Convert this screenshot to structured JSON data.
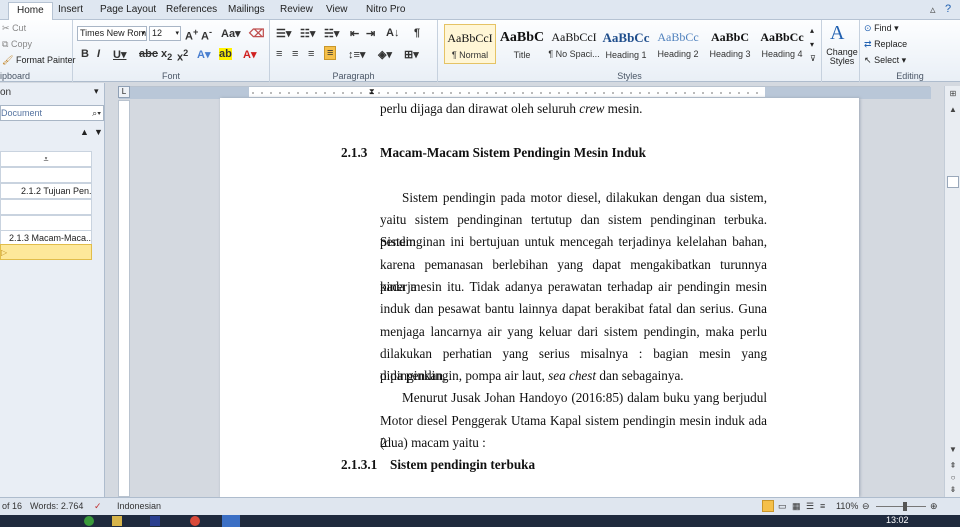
{
  "tabs": [
    "Home",
    "Insert",
    "Page Layout",
    "References",
    "Mailings",
    "Review",
    "View",
    "Nitro Pro"
  ],
  "clipboard": {
    "cut": "Cut",
    "copy": "Copy",
    "format_painter": "Format Painter",
    "label": "ipboard"
  },
  "font": {
    "name": "Times New Rom",
    "size": "12",
    "label": "Font"
  },
  "paragraph": {
    "label": "Paragraph"
  },
  "styles": {
    "label": "Styles",
    "items": [
      {
        "sample": "AaBbCcI",
        "name": "¶ Normal"
      },
      {
        "sample": "AaBbC",
        "name": "Title"
      },
      {
        "sample": "AaBbCcI",
        "name": "¶ No Spaci..."
      },
      {
        "sample": "AaBbCc",
        "name": "Heading 1"
      },
      {
        "sample": "AaBbCc",
        "name": "Heading 2"
      },
      {
        "sample": "AaBbC",
        "name": "Heading 3"
      },
      {
        "sample": "AaBbCc",
        "name": "Heading 4"
      }
    ],
    "change_styles": "Change Styles"
  },
  "editing": {
    "find": "Find",
    "replace": "Replace",
    "select": "Select",
    "label": "Editing"
  },
  "nav": {
    "title": "on",
    "search_text": "Document",
    "items": [
      "2.1.2 Tujuan Pen...",
      "2.1.3  Macam-Maca..."
    ]
  },
  "document": {
    "line_top": "perlu dijaga dan dirawat oleh seluruh",
    "line_top_italic": "crew",
    "line_top_end": "mesin.",
    "heading_num": "2.1.3",
    "heading_text": "Macam-Macam Sistem Pendingin Mesin Induk",
    "p1": [
      "Sistem pendingin pada motor diesel, dilakukan dengan dua sistem,",
      "yaitu sistem pendinginan tertutup dan sistem pendinginan terbuka. Sistem",
      "pendinginan ini bertujuan untuk mencegah terjadinya kelelahan bahan,",
      "karena pemanasan berlebihan yang dapat mengakibatkan turunnya kinerja",
      "pada mesin itu. Tidak adanya perawatan terhadap air pendingin mesin",
      "induk dan pesawat bantu lainnya dapat berakibat fatal dan serius. Guna",
      "menjaga lancarnya air yang keluar dari sistem pendingin, maka perlu",
      "dilakukan perhatian yang serius misalnya : bagian mesin yang didinginkan,"
    ],
    "p1_last": "pipa pendingin, pompa air laut,",
    "p1_last_italic": "sea chest",
    "p1_last_end": "dan sebagainya.",
    "p2": [
      "Menurut Jusak Johan Handoyo (2016:85) dalam buku yang berjudul",
      "Motor diesel Penggerak Utama Kapal sistem pendingin mesin induk ada 2"
    ],
    "p2_last": "(dua) macam yaitu :",
    "sub_num": "2.1.3.1",
    "sub_text": "Sistem pendingin terbuka"
  },
  "status": {
    "page": "of 16",
    "words": "Words: 2.764",
    "language": "Indonesian",
    "zoom": "110%"
  },
  "clock": "13:02"
}
